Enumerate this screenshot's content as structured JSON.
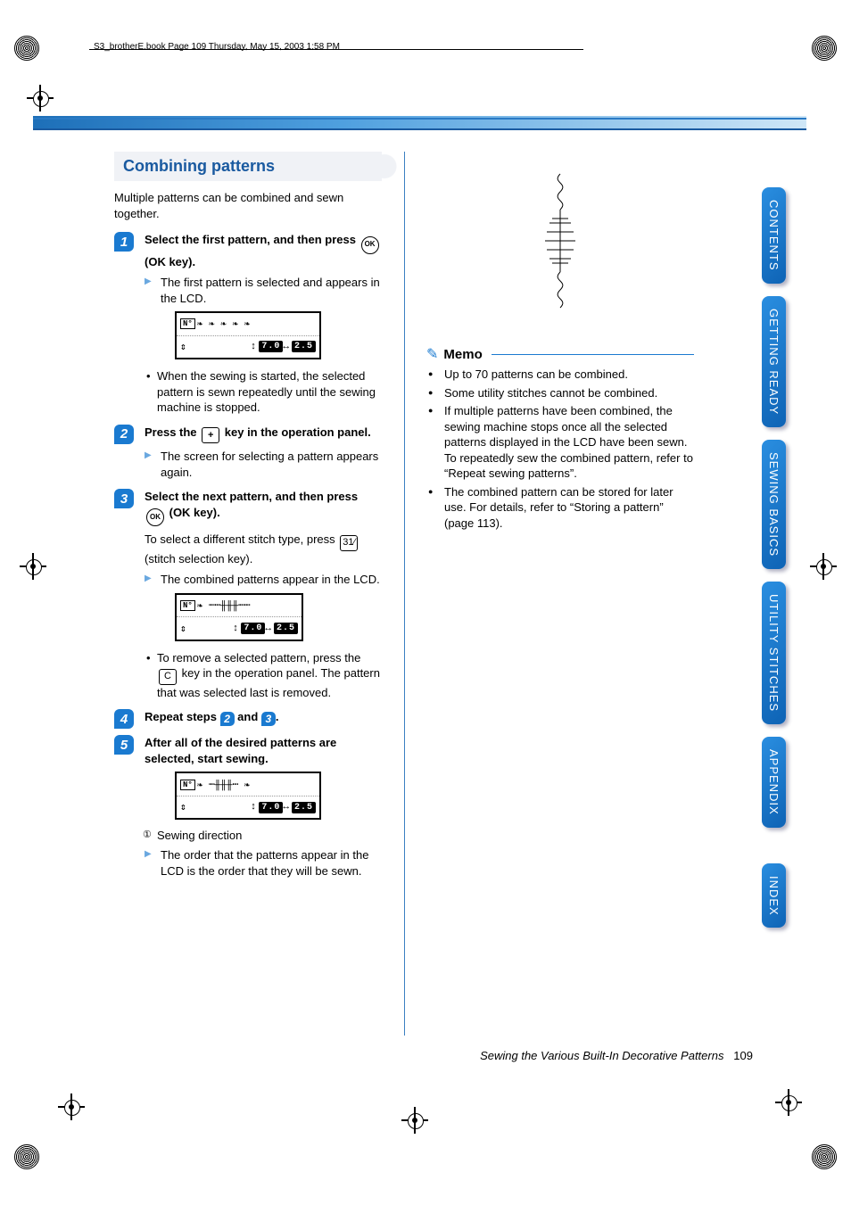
{
  "header_line": "S3_brotherE.book  Page 109  Thursday, May 15, 2003  1:58 PM",
  "section_title": "Combining patterns",
  "intro": "Multiple patterns can be combined and sewn together.",
  "steps": {
    "s1": {
      "num": "1",
      "head_a": "Select the first pattern, and then press ",
      "head_b": " (OK key).",
      "sub": "The first pattern is selected and appears in the LCD.",
      "bullet": "When the sewing is started, the selected pattern is sewn repeatedly until the sewing machine is stopped."
    },
    "s2": {
      "num": "2",
      "head_a": "Press the ",
      "head_b": " key in the operation panel.",
      "sub": "The screen for selecting a pattern appears again."
    },
    "s3": {
      "num": "3",
      "head_a": "Select the next pattern, and then press ",
      "head_b": " (OK key).",
      "note_a": "To select a different stitch type, press ",
      "note_b": " (stitch selection key).",
      "sub": "The combined patterns appear in the LCD.",
      "bullet_a": "To remove a selected pattern, press the ",
      "bullet_b": " key in the operation panel. The pattern that was selected last is removed."
    },
    "s4": {
      "num": "4",
      "head_a": "Repeat steps ",
      "head_b": " and ",
      "head_c": ".",
      "ref2": "2",
      "ref3": "3"
    },
    "s5": {
      "num": "5",
      "head": "After all of the desired patterns are selected, start sewing.",
      "caption": "Sewing direction",
      "sub": "The order that the patterns appear in the LCD is the order that they will be sewn."
    }
  },
  "lcd": {
    "badge": "N°",
    "val1": "7.0",
    "val2": "2.5"
  },
  "keys": {
    "ok": "OK",
    "plus": "+",
    "stitch": "31⁄",
    "c": "C"
  },
  "memo": {
    "title": "Memo",
    "items": [
      "Up to 70 patterns can be combined.",
      "Some utility stitches cannot be combined.",
      "If multiple patterns have been combined, the sewing machine stops once all the selected patterns displayed in the LCD have been sewn. To repeatedly sew the combined pattern, refer to “Repeat sewing patterns”.",
      "The combined pattern can be stored for later use. For details, refer to “Storing a pattern” (page 113)."
    ]
  },
  "tabs": [
    "CONTENTS",
    "GETTING READY",
    "SEWING BASICS",
    "UTILITY STITCHES",
    "APPENDIX",
    "INDEX"
  ],
  "footer_title": "Sewing the Various Built-In Decorative Patterns",
  "footer_page": "109"
}
